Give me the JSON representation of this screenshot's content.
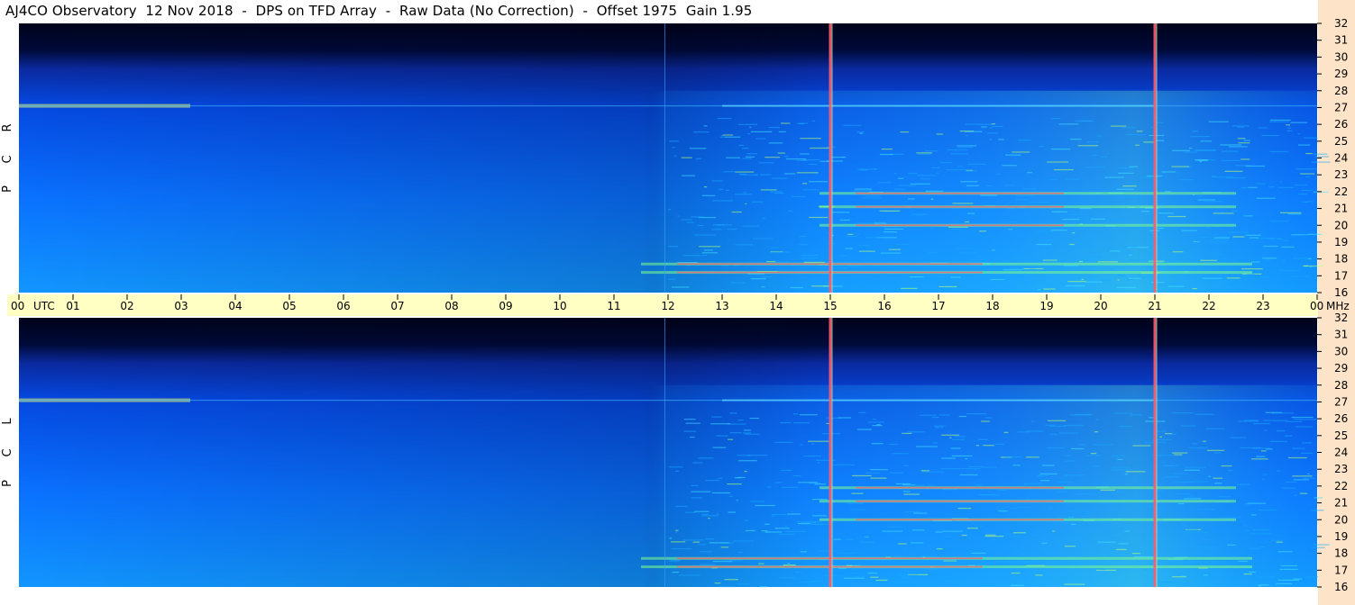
{
  "title": "AJ4CO Observatory  12 Nov 2018  -  DPS on TFD Array  -  Raw Data (No Correction)  -  Offset 1975  Gain 1.95",
  "colors": {
    "background": "#ffffff",
    "freq_strip": "#fde4c8",
    "time_strip": "#ffffc4",
    "spectro_dark": "#00031a",
    "spectro_mid": "#0060ff",
    "spectro_bright": "#14a8ff",
    "rfi_line": "#ff5a6e",
    "hot": "#f0ff60"
  },
  "chart_data": {
    "type": "heatmap",
    "title": "AJ4CO Observatory  12 Nov 2018  -  DPS on TFD Array  -  Raw Data (No Correction)  -  Offset 1975  Gain 1.95",
    "x_unit_label": "UTC",
    "y_unit_label": "MHz",
    "x_ticks": [
      "00",
      "01",
      "02",
      "03",
      "04",
      "05",
      "06",
      "07",
      "08",
      "09",
      "10",
      "11",
      "12",
      "13",
      "14",
      "15",
      "16",
      "17",
      "18",
      "19",
      "20",
      "21",
      "22",
      "23",
      "00"
    ],
    "y_ticks": [
      16,
      17,
      18,
      19,
      20,
      21,
      22,
      23,
      24,
      25,
      26,
      27,
      28,
      29,
      30,
      31,
      32
    ],
    "xlim_hours": [
      0,
      24
    ],
    "ylim_mhz": [
      16,
      32
    ],
    "panels": [
      {
        "name": "R C P",
        "polarization_label": "R C P"
      },
      {
        "name": "L C P",
        "polarization_label": "L C P"
      }
    ],
    "rfi_vertical_lines_hours": [
      15,
      21
    ],
    "notable_bands_mhz": [
      27.1,
      20.0,
      17.7,
      17.2,
      21.1,
      21.9
    ],
    "daytime_brightening_start_hour": 12
  }
}
